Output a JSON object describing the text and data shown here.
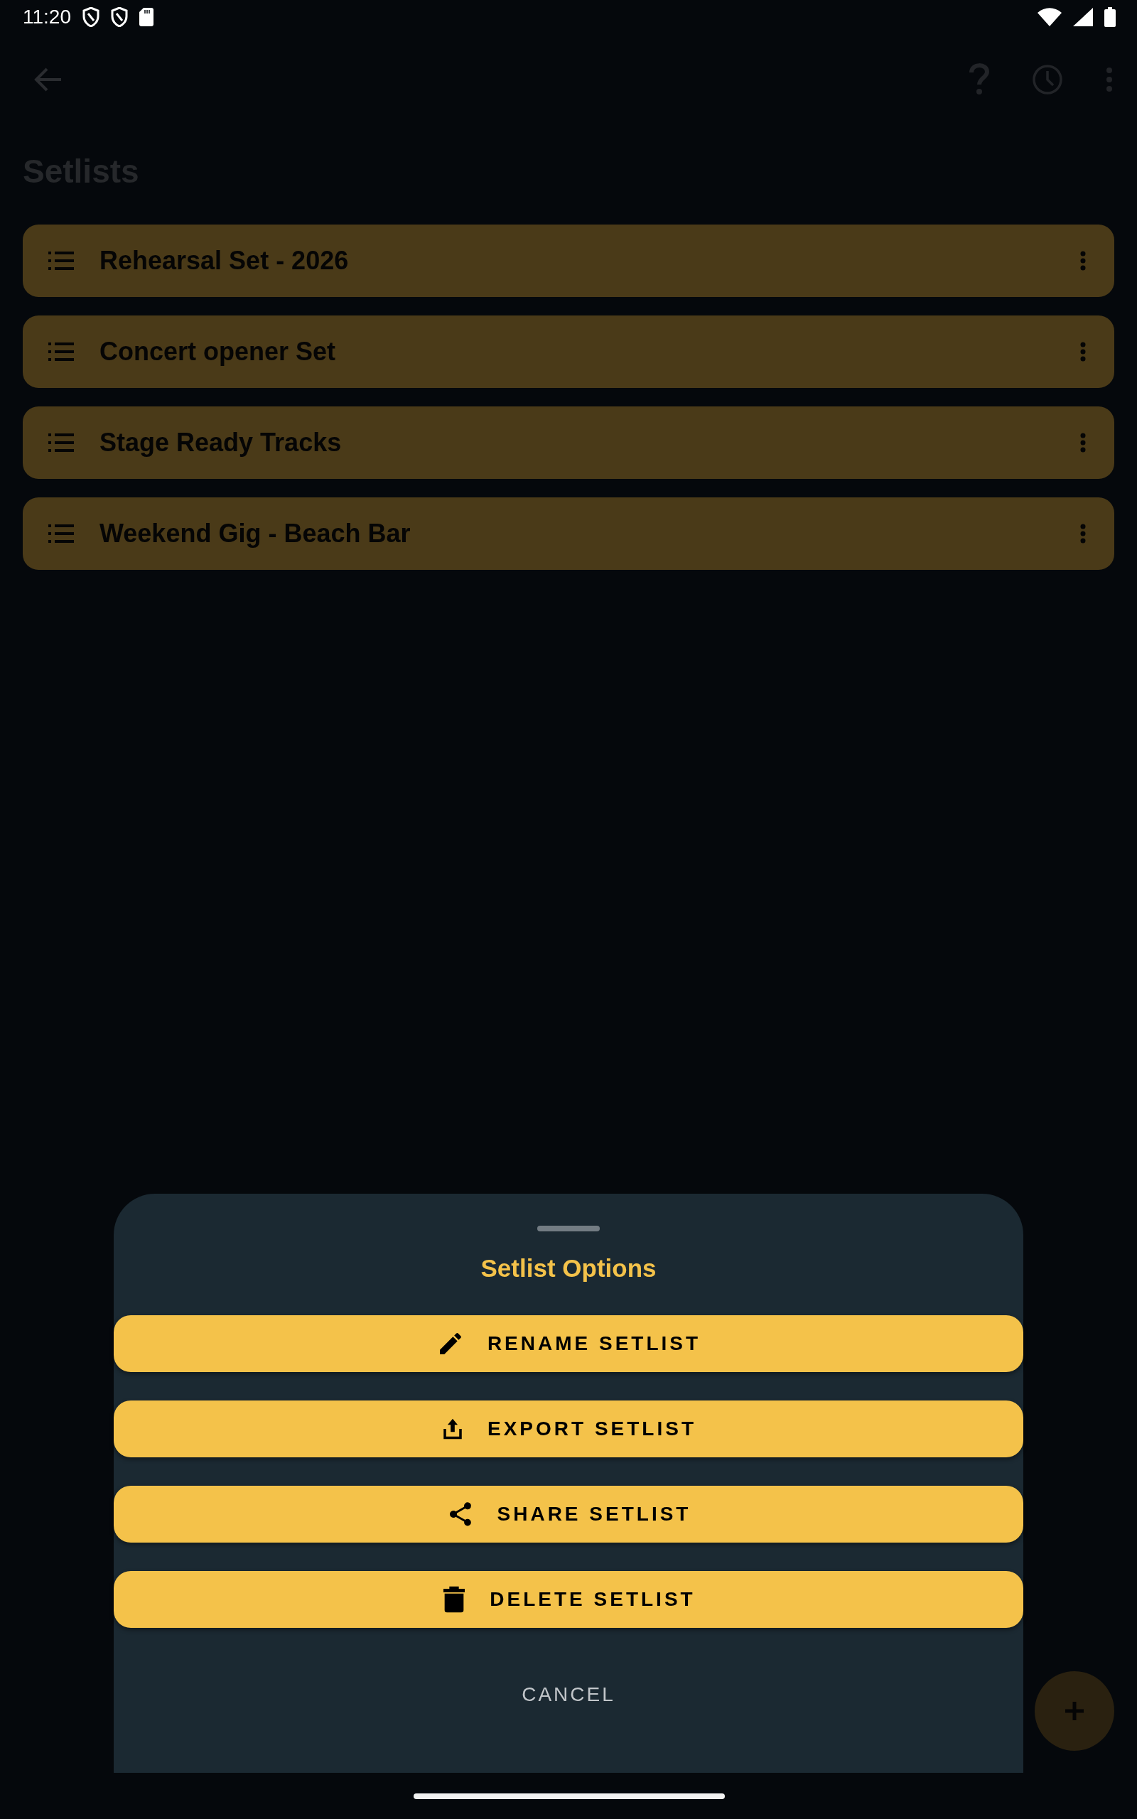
{
  "status_bar": {
    "time": "11:20"
  },
  "app_bar": {
    "title": "Setlists"
  },
  "setlists": [
    {
      "name": "Rehearsal Set - 2026"
    },
    {
      "name": "Concert opener Set"
    },
    {
      "name": "Stage Ready Tracks"
    },
    {
      "name": "Weekend Gig - Beach Bar"
    }
  ],
  "sheet": {
    "title": "Setlist Options",
    "actions": [
      {
        "label": "RENAME SETLIST",
        "kind": "rename"
      },
      {
        "label": "EXPORT SETLIST",
        "kind": "export"
      },
      {
        "label": "SHARE SETLIST",
        "kind": "share"
      },
      {
        "label": "DELETE SETLIST",
        "kind": "delete"
      }
    ],
    "cancel": "CANCEL"
  }
}
